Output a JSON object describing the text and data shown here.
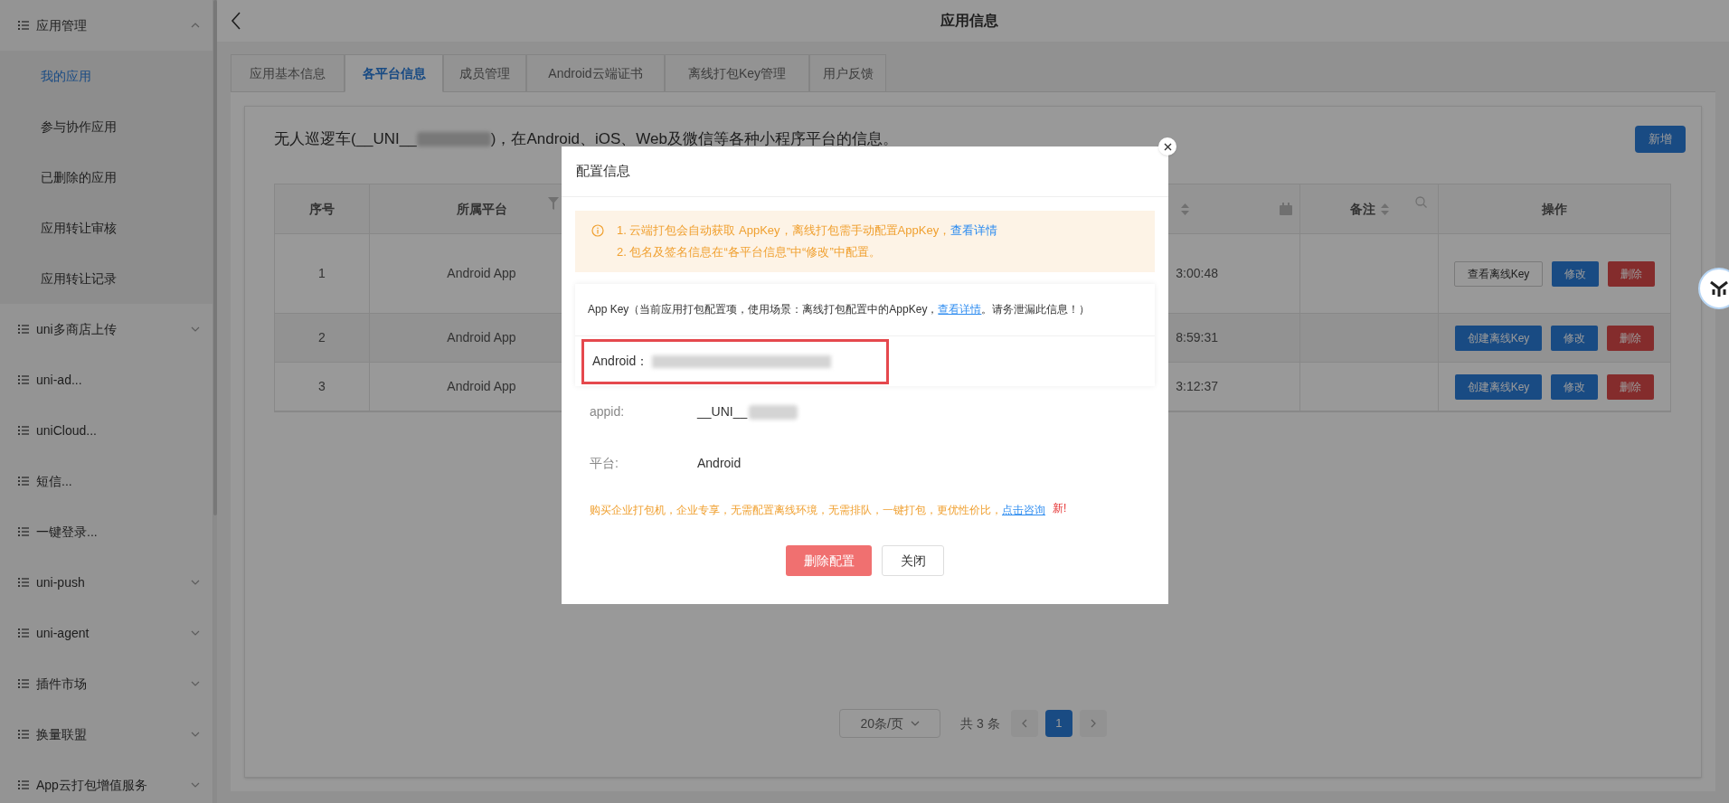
{
  "sidebar": {
    "items": [
      {
        "label": "应用管理",
        "expanded": true,
        "children": [
          {
            "label": "我的应用",
            "selected": true
          },
          {
            "label": "参与协作应用",
            "selected": false
          },
          {
            "label": "已删除的应用",
            "selected": false
          },
          {
            "label": "应用转让审核",
            "selected": false
          },
          {
            "label": "应用转让记录",
            "selected": false
          }
        ]
      },
      {
        "label": "uni多商店上传",
        "expanded": false
      },
      {
        "label": "uni-ad..."
      },
      {
        "label": "uniCloud..."
      },
      {
        "label": "短信..."
      },
      {
        "label": "一键登录..."
      },
      {
        "label": "uni-push",
        "expanded": false
      },
      {
        "label": "uni-agent",
        "expanded": false
      },
      {
        "label": "插件市场",
        "expanded": false
      },
      {
        "label": "换量联盟",
        "expanded": false
      },
      {
        "label": "App云打包增值服务",
        "expanded": false
      }
    ]
  },
  "header": {
    "title": "应用信息"
  },
  "tabs": [
    {
      "label": "应用基本信息",
      "selected": false
    },
    {
      "label": "各平台信息",
      "selected": true
    },
    {
      "label": "成员管理",
      "selected": false
    },
    {
      "label": "Android云端证书",
      "selected": false
    },
    {
      "label": "离线打包Key管理",
      "selected": false
    },
    {
      "label": "用户反馈",
      "selected": false
    }
  ],
  "intro": {
    "before": "无人巡逻车(__UNI__",
    "after": ")，在Android、iOS、Web及微信等各种小程序平台的信息。"
  },
  "add_button": "新增",
  "table": {
    "columns": [
      "序号",
      "所属平台",
      "备注",
      "操作"
    ],
    "rows": [
      {
        "index": "1",
        "platform": "Android App",
        "time": "3:00:48",
        "actions": [
          {
            "label": "查看离线Key",
            "kind": "outline"
          },
          {
            "label": "修改",
            "kind": "primary"
          },
          {
            "label": "删除",
            "kind": "danger"
          }
        ]
      },
      {
        "index": "2",
        "platform": "Android App",
        "time": "8:59:31",
        "actions": [
          {
            "label": "创建离线Key",
            "kind": "primary"
          },
          {
            "label": "修改",
            "kind": "primary"
          },
          {
            "label": "删除",
            "kind": "danger"
          }
        ]
      },
      {
        "index": "3",
        "platform": "Android App",
        "time": "3:12:37",
        "actions": [
          {
            "label": "创建离线Key",
            "kind": "primary"
          },
          {
            "label": "修改",
            "kind": "primary"
          },
          {
            "label": "删除",
            "kind": "danger"
          }
        ]
      }
    ]
  },
  "pagination": {
    "page_size": "20条/页",
    "total": "共 3 条",
    "pages": [
      {
        "label": "1",
        "selected": true
      }
    ]
  },
  "modal": {
    "title": "配置信息",
    "notice": [
      {
        "text": "1. 云端打包会自动获取 AppKey，离线打包需手动配置AppKey，",
        "link": "查看详情"
      },
      {
        "text": "2. 包名及签名信息在“各平台信息”中“修改”中配置。"
      }
    ],
    "appkey_note": {
      "before": "App Key（当前应用打包配置项，使用场景：离线打包配置中的AppKey，",
      "link": "查看详情",
      "after": "。请务泄漏此信息！）"
    },
    "android_label": "Android：",
    "fields": [
      {
        "label": "appid:",
        "value": "__UNI__"
      },
      {
        "label": "平台:",
        "value": "Android"
      }
    ],
    "promo": {
      "text": "购买企业打包机，企业专享，无需配置离线环境，无需排队，一键打包，更优性价比，",
      "link": "点击咨询",
      "badge": "新!"
    },
    "buttons": [
      {
        "label": "删除配置",
        "kind": "danger"
      },
      {
        "label": "关闭",
        "kind": "default"
      }
    ]
  }
}
